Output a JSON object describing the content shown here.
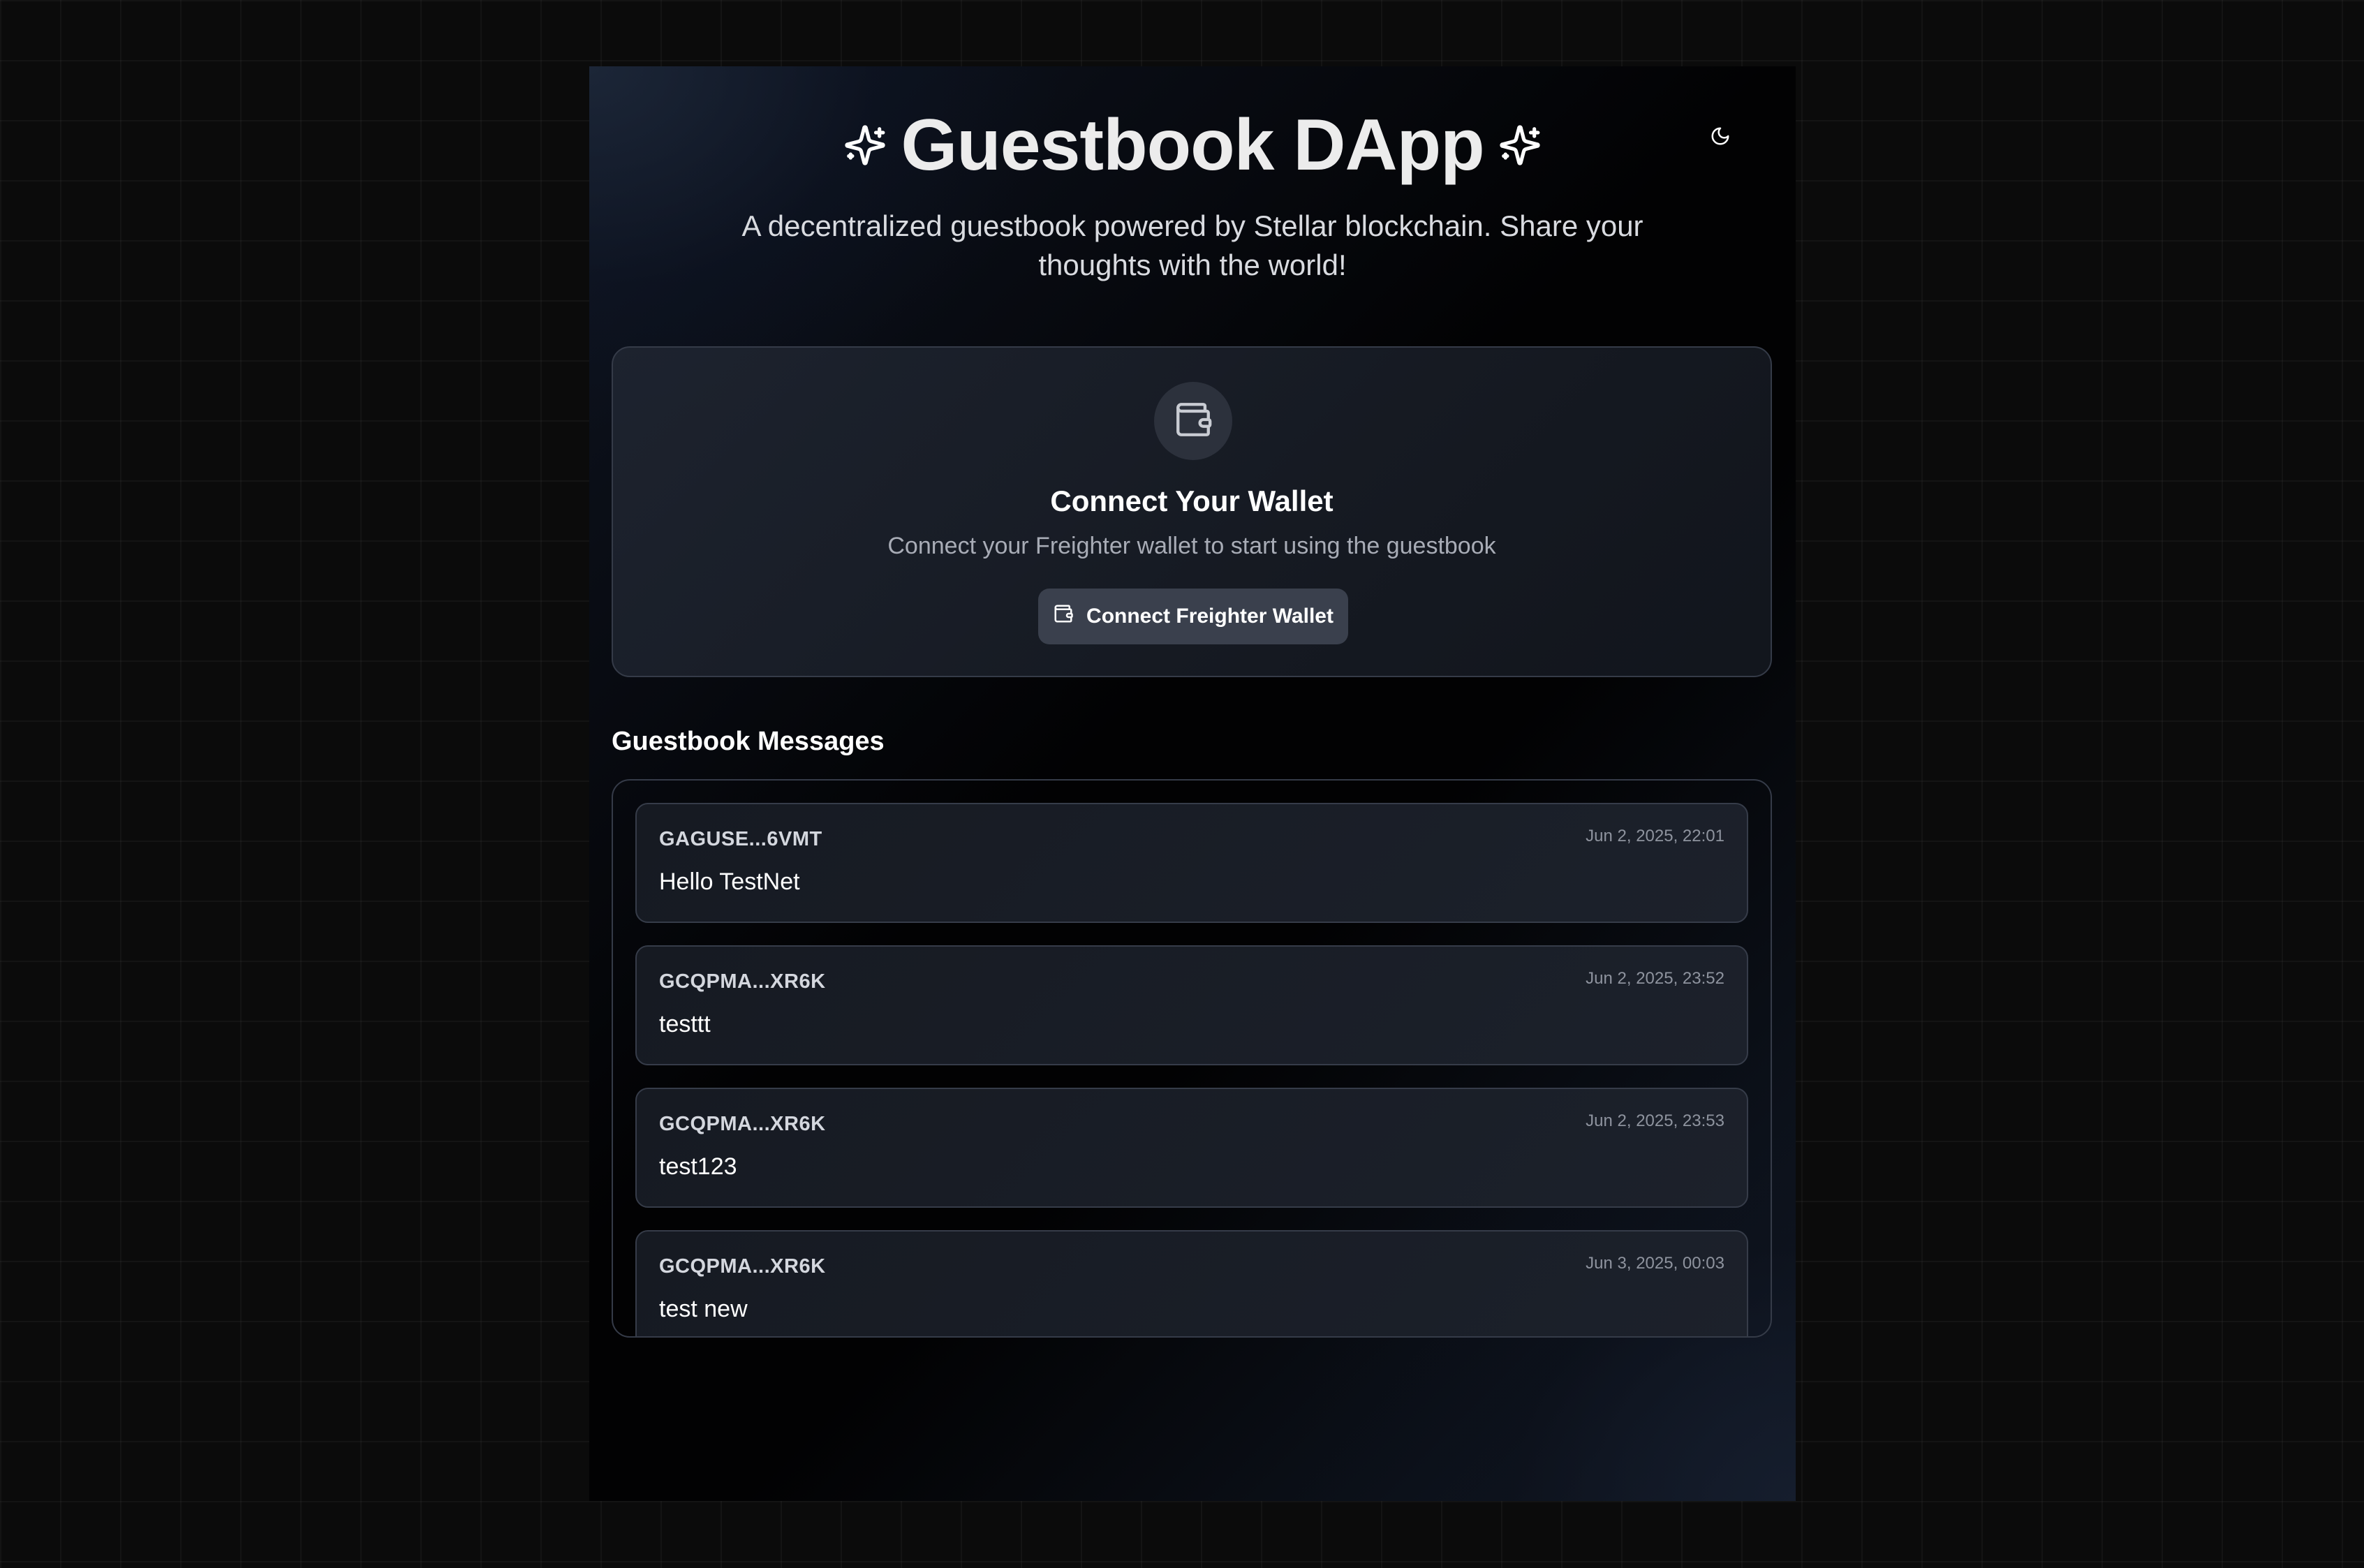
{
  "app": {
    "title": "Guestbook DApp",
    "subtitle": "A decentralized guestbook powered by Stellar blockchain. Share your thoughts with the world!",
    "theme_toggle_icon": "moon-icon",
    "title_icon": "sparkles-icon"
  },
  "wallet": {
    "icon": "wallet-icon",
    "title": "Connect Your Wallet",
    "description": "Connect your Freighter wallet to start using the guestbook",
    "button_label": "Connect Freighter Wallet"
  },
  "messages": {
    "heading": "Guestbook Messages",
    "items": [
      {
        "author": "GAGUSE...6VMT",
        "time": "Jun 2, 2025, 22:01",
        "text": "Hello TestNet"
      },
      {
        "author": "GCQPMA...XR6K",
        "time": "Jun 2, 2025, 23:52",
        "text": "testtt"
      },
      {
        "author": "GCQPMA...XR6K",
        "time": "Jun 2, 2025, 23:53",
        "text": "test123"
      },
      {
        "author": "GCQPMA...XR6K",
        "time": "Jun 3, 2025, 00:03",
        "text": "test new"
      }
    ]
  },
  "colors": {
    "page_background": "#0b0b0b",
    "card_border": "#353b48",
    "button_background": "#3a404d",
    "muted_text": "#a8acb6"
  }
}
